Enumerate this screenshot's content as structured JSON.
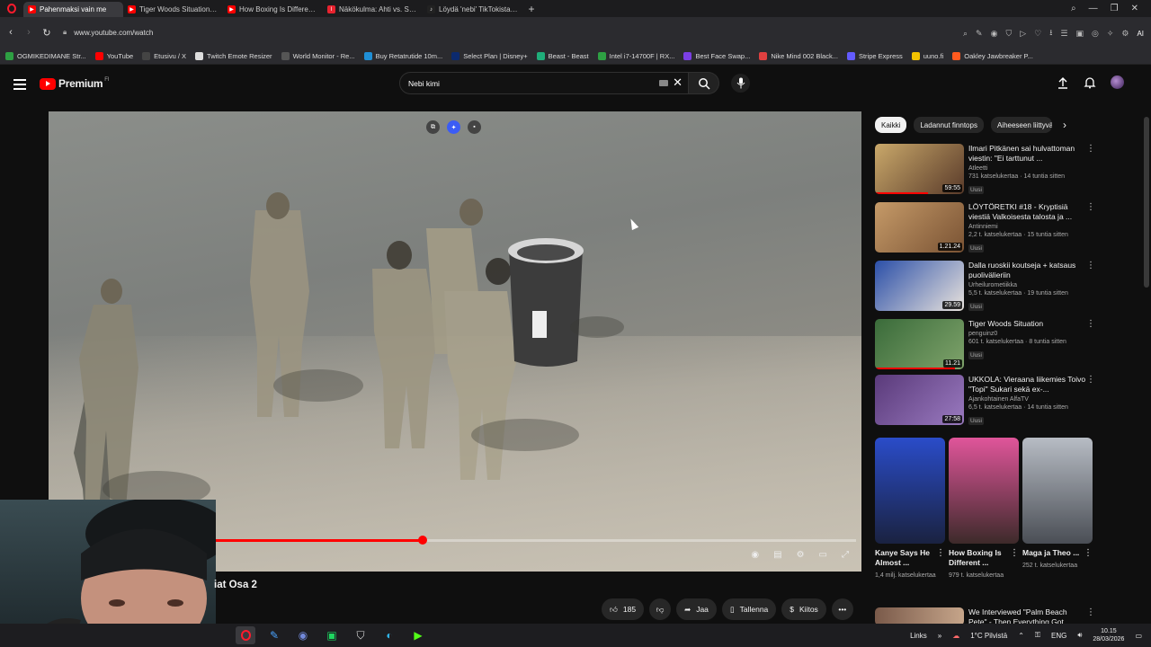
{
  "browser": {
    "tabs": [
      {
        "title": "Pahenmaksi vain me",
        "active": true,
        "color": "#ff0000"
      },
      {
        "title": "Tiger Woods Situation - Yo",
        "active": false,
        "color": "#ff0000"
      },
      {
        "title": "How Boxing Is Different Fr",
        "active": false,
        "color": "#ff0000"
      },
      {
        "title": "Näkökulma: Ahti vs. Sann",
        "active": false,
        "color": "#e8232f"
      },
      {
        "title": "Löydä 'nebi' TikTokista | Ti",
        "active": false,
        "color": "#222"
      }
    ],
    "url": "www.youtube.com/watch",
    "ai_label": "AI",
    "bookmarks": [
      {
        "label": "OGMIKEDIMANE Str...",
        "color": "#2ea043"
      },
      {
        "label": "YouTube",
        "color": "#ff0000"
      },
      {
        "label": "Etusivu / X",
        "color": "#222"
      },
      {
        "label": "Twitch Emote Resizer",
        "color": "#ddd"
      },
      {
        "label": "World Monitor - Re...",
        "color": "#333"
      },
      {
        "label": "Buy Retatrutide 10m...",
        "color": "#1f8fd6"
      },
      {
        "label": "Select Plan | Disney+",
        "color": "#0c2a6e"
      },
      {
        "label": "Beast - Beast",
        "color": "#1fae7a"
      },
      {
        "label": "Intel i7-14700F | RX...",
        "color": "#2ea043"
      },
      {
        "label": "Best Face Swap...",
        "color": "#7b3fe4"
      },
      {
        "label": "Nike Mind 002 Black...",
        "color": "#e04040"
      },
      {
        "label": "Stripe Express",
        "color": "#635bff"
      },
      {
        "label": "uuno.fi",
        "color": "#f2c200"
      },
      {
        "label": "Oakley Jawbreaker P...",
        "color": "#ff5a1f"
      }
    ]
  },
  "youtube": {
    "logo_text": "Premium",
    "logo_sup": "FI",
    "search_value": "Nebi kimi",
    "video": {
      "progress_fraction": 0.46,
      "title": "iat Osa 2"
    },
    "actions": {
      "likes": "185",
      "share": "Jaa",
      "save": "Tallenna",
      "thanks": "Kiitos"
    },
    "chips": [
      "Kaikki",
      "Ladannut finntops",
      "Aiheeseen liittyvä"
    ],
    "recommendations": [
      {
        "title": "Ilmari Pitkänen sai hulvattoman viestin: \"Ei tarttunut ...",
        "channel": "Atleetti",
        "stats": "731 katselukertaa · 14 tuntia sitten",
        "badge": "Uusi",
        "duration": "59:55",
        "progress": 0.6,
        "thumb": "linear-gradient(135deg,#c9a86a,#5a3b2a)"
      },
      {
        "title": "LÖYTÖRETKI #18 - Kryptisiä viestiä Valkoisesta talosta ja ...",
        "channel": "Antinniemi",
        "stats": "2,2 t. katselukertaa · 15 tuntia sitten",
        "badge": "Uusi",
        "duration": "1.21.24",
        "progress": 0,
        "thumb": "linear-gradient(135deg,#c59a68,#7a5334)"
      },
      {
        "title": "Dalla ruoskii koutseja + katsaus puolivälieriin",
        "channel": "Urheilurometiikka",
        "stats": "5,5 t. katselukertaa · 19 tuntia sitten",
        "badge": "Uusi",
        "duration": "29.59",
        "progress": 0,
        "thumb": "linear-gradient(135deg,#2b4fa8,#e9e3dd)"
      },
      {
        "title": "Tiger Woods Situation",
        "channel": "penguinz0",
        "stats": "601 t. katselukertaa · 8 tuntia sitten",
        "badge": "Uusi",
        "duration": "11.21",
        "progress": 0.9,
        "thumb": "linear-gradient(135deg,#3a6b3a,#7fa36b)"
      },
      {
        "title": "UKKOLA: Vieraana liikemies Toivo \"Topi\" Sukari sekä ex-...",
        "channel": "Ajankohtainen AlfaTV",
        "stats": "6,5 t. katselukertaa · 14 tuntia sitten",
        "badge": "Uusi",
        "duration": "27:58",
        "progress": 0,
        "thumb": "linear-gradient(135deg,#5a3a7a,#9a7ac0)"
      }
    ],
    "shorts": [
      {
        "title": "Kanye Says He Almost ...",
        "views": "1,4 milj. katselukertaa",
        "thumb": "linear-gradient(180deg,#2a4cc9,#1a2240)"
      },
      {
        "title": "How Boxing Is Different ...",
        "views": "979 t. katselukertaa",
        "thumb": "linear-gradient(180deg,#e0559a,#3d2a2a)"
      },
      {
        "title": "Maga ja Theo ...",
        "views": "252 t. katselukertaa",
        "thumb": "linear-gradient(180deg,#b7bcc4,#4a4e55)"
      }
    ],
    "last_rec": {
      "title": "We Interviewed \"Palm Beach Pete\" - Then Everything Got..."
    }
  },
  "taskbar": {
    "links_label": "Links",
    "weather": "1°C  Pilvistä",
    "lang": "ENG",
    "time": "10.15",
    "date": "28/03/2026"
  }
}
